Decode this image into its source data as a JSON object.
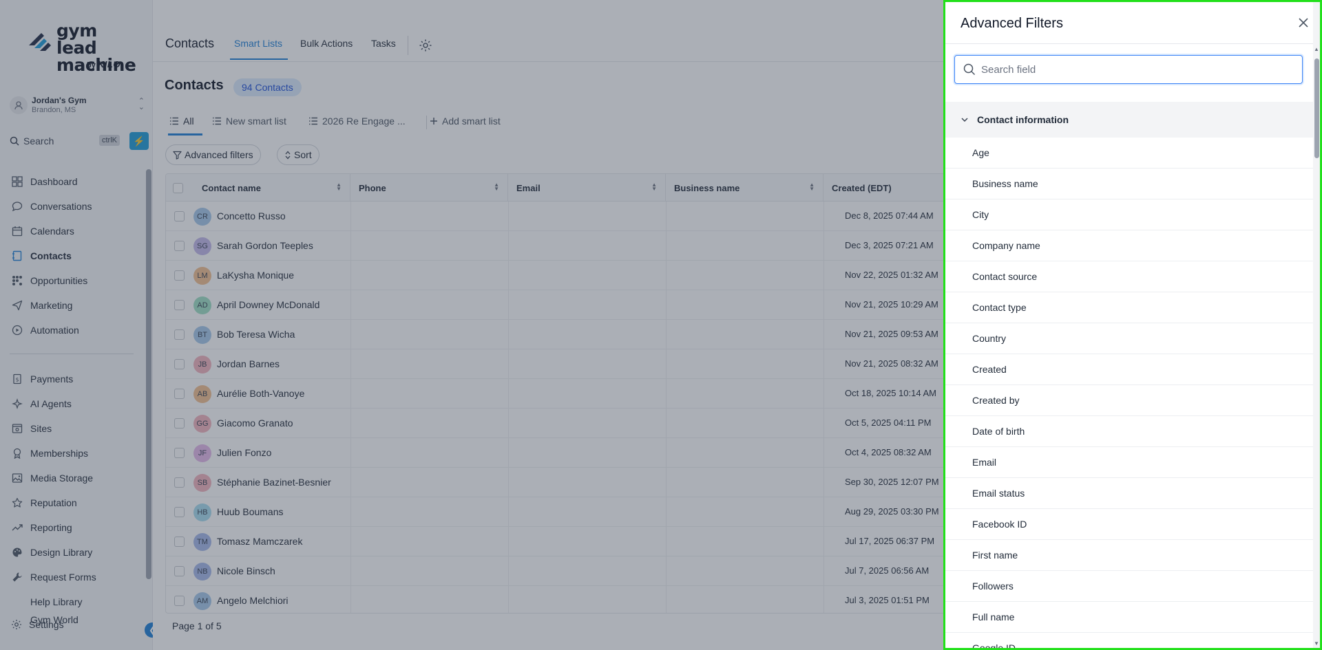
{
  "brand": {
    "line1": "gym lead",
    "line2": "machine",
    "by": "by",
    "kilo": "KILO"
  },
  "location": {
    "name": "Jordan's Gym",
    "city": "Brandon, MS"
  },
  "search": {
    "label": "Search",
    "shortcut": "ctrlK"
  },
  "sidebar": {
    "items": [
      {
        "label": "Dashboard",
        "icon": "dashboard-icon"
      },
      {
        "label": "Conversations",
        "icon": "chat-icon"
      },
      {
        "label": "Calendars",
        "icon": "calendar-icon"
      },
      {
        "label": "Contacts",
        "icon": "contacts-icon",
        "active": true
      },
      {
        "label": "Opportunities",
        "icon": "opportunities-icon"
      },
      {
        "label": "Marketing",
        "icon": "send-icon"
      },
      {
        "label": "Automation",
        "icon": "automation-icon"
      }
    ],
    "items2": [
      {
        "label": "Payments",
        "icon": "payments-icon"
      },
      {
        "label": "AI Agents",
        "icon": "sparkle-icon"
      },
      {
        "label": "Sites",
        "icon": "sites-icon"
      },
      {
        "label": "Memberships",
        "icon": "award-icon"
      },
      {
        "label": "Media Storage",
        "icon": "image-icon"
      },
      {
        "label": "Reputation",
        "icon": "star-icon"
      },
      {
        "label": "Reporting",
        "icon": "trend-icon"
      },
      {
        "label": "Design Library",
        "icon": "palette-icon"
      },
      {
        "label": "Request Forms",
        "icon": "wrench-icon"
      },
      {
        "label": "Help Library",
        "icon": ""
      },
      {
        "label": "Gym World",
        "icon": ""
      }
    ],
    "settings": "Settings"
  },
  "header": {
    "title": "Contacts",
    "tabs": [
      "Smart Lists",
      "Bulk Actions",
      "Tasks"
    ]
  },
  "page": {
    "title": "Contacts",
    "count": "94 Contacts",
    "smart_tabs": [
      "All",
      "New smart list",
      "2026 Re Engage ...",
      "Add smart list"
    ],
    "advanced_filters": "Advanced filters",
    "sort": "Sort",
    "pager": "Page 1 of 5"
  },
  "table": {
    "columns": [
      "Contact name",
      "Phone",
      "Email",
      "Business name",
      "Created (EDT)"
    ],
    "rows": [
      {
        "initials": "CR",
        "name": "Concetto Russo",
        "created": "Dec 8, 2025 07:44 AM",
        "color": "#a5c8ea"
      },
      {
        "initials": "SG",
        "name": "Sarah Gordon Teeples",
        "created": "Dec 3, 2025 07:21 AM",
        "color": "#c3b8ea"
      },
      {
        "initials": "LM",
        "name": "LaKysha Monique",
        "created": "Nov 22, 2025 01:32 AM",
        "color": "#f3c08f"
      },
      {
        "initials": "AD",
        "name": "April Downey McDonald",
        "created": "Nov 21, 2025 10:29 AM",
        "color": "#9fe0c4"
      },
      {
        "initials": "BT",
        "name": "Bob Teresa Wicha",
        "created": "Nov 21, 2025 09:53 AM",
        "color": "#a5c8ea"
      },
      {
        "initials": "JB",
        "name": "Jordan Barnes",
        "created": "Nov 21, 2025 08:32 AM",
        "color": "#f3b3bd"
      },
      {
        "initials": "AB",
        "name": "Aurélie Both-Vanoye",
        "created": "Oct 18, 2025 10:14 AM",
        "color": "#f3c08f"
      },
      {
        "initials": "GG",
        "name": "Giacomo Granato",
        "created": "Oct 5, 2025 04:11 PM",
        "color": "#f3b3bd"
      },
      {
        "initials": "JF",
        "name": "Julien Fonzo",
        "created": "Oct 4, 2025 08:32 AM",
        "color": "#e5b8ea"
      },
      {
        "initials": "SB",
        "name": "Stéphanie Bazinet-Besnier",
        "created": "Sep 30, 2025 12:07 PM",
        "color": "#f3b3bd"
      },
      {
        "initials": "HB",
        "name": "Huub Boumans",
        "created": "Aug 29, 2025 03:30 PM",
        "color": "#a8dcef"
      },
      {
        "initials": "TM",
        "name": "Tomasz Mamczarek",
        "created": "Jul 17, 2025 06:37 PM",
        "color": "#a5b8ea"
      },
      {
        "initials": "NB",
        "name": "Nicole Binsch",
        "created": "Jul 7, 2025 06:56 AM",
        "color": "#a5b8ea"
      },
      {
        "initials": "AM",
        "name": "Angelo Melchiori",
        "created": "Jul 3, 2025 01:51 PM",
        "color": "#a5c8ea"
      }
    ]
  },
  "panel": {
    "title": "Advanced Filters",
    "search_placeholder": "Search field",
    "section": "Contact information",
    "fields": [
      "Age",
      "Business name",
      "City",
      "Company name",
      "Contact source",
      "Contact type",
      "Country",
      "Created",
      "Created by",
      "Date of birth",
      "Email",
      "Email status",
      "Facebook ID",
      "First name",
      "Followers",
      "Full name",
      "Google ID"
    ]
  },
  "colors": {
    "accent": "#1d7fd6",
    "highlight_border": "#22e01a",
    "overlay": "#374151"
  }
}
